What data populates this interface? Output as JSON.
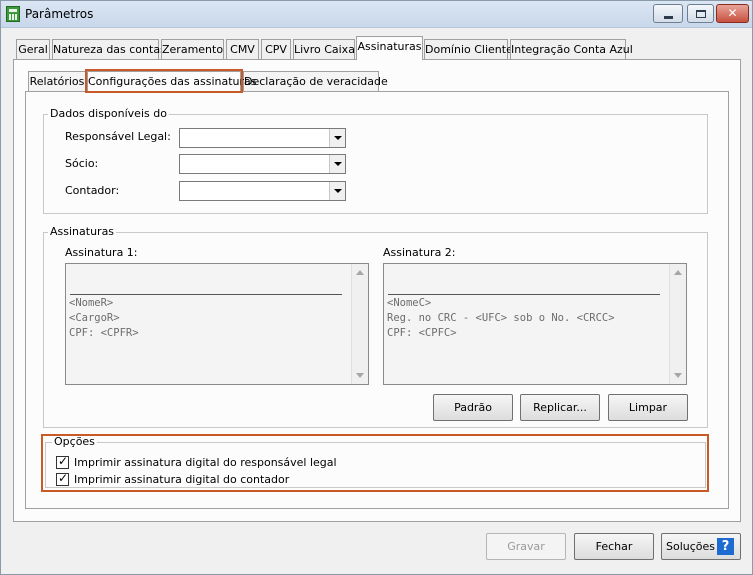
{
  "window": {
    "title": "Parâmetros"
  },
  "tabs": [
    "Geral",
    "Natureza das contas",
    "Zeramento",
    "CMV",
    "CPV",
    "Livro Caixa",
    "Assinaturas",
    "Domínio Cliente",
    "Integração Conta Azul"
  ],
  "subtabs": [
    "Relatórios",
    "Configurações das assinaturas",
    "Declaração de veracidade"
  ],
  "dados": {
    "legend": "Dados disponíveis do",
    "responsavel_label": "Responsável Legal:",
    "socio_label": "Sócio:",
    "contador_label": "Contador:",
    "responsavel_value": "",
    "socio_value": "",
    "contador_value": ""
  },
  "assinaturas": {
    "legend": "Assinaturas",
    "assinatura1_label": "Assinatura 1:",
    "assinatura2_label": "Assinatura 2:",
    "assinatura1_lines": [
      "<NomeR>",
      "<CargoR>",
      "CPF: <CPFR>"
    ],
    "assinatura2_lines": [
      "<NomeC>",
      "Reg. no CRC - <UFC> sob o No. <CRCC>",
      "CPF: <CPFC>"
    ],
    "padrao_label": "Padrão",
    "replicar_label": "Replicar...",
    "limpar_label": "Limpar"
  },
  "opcoes": {
    "legend": "Opções",
    "opt1_label": "Imprimir assinatura digital do responsável legal",
    "opt1_checked": true,
    "opt2_label": "Imprimir assinatura digital do contador",
    "opt2_checked": true
  },
  "footer": {
    "gravar_label": "Gravar",
    "fechar_label": "Fechar",
    "solucoes_label": "Soluções",
    "help_glyph": "?"
  },
  "colors": {
    "highlight": "#c85a28",
    "help_icon": "#1d6bd0"
  }
}
